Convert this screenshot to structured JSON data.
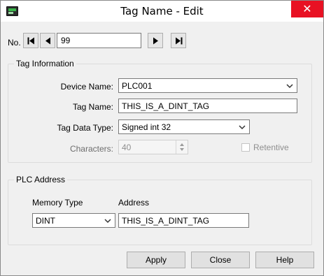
{
  "window": {
    "title": "Tag Name - Edit",
    "close_glyph": "✕"
  },
  "nav": {
    "no_label": "No.",
    "record_value": "99",
    "buttons": [
      {
        "icon": "first-record-icon"
      },
      {
        "icon": "previous-record-icon"
      },
      {
        "icon": "next-record-icon"
      },
      {
        "icon": "last-record-icon"
      }
    ]
  },
  "tag_info": {
    "legend": "Tag Information",
    "device_name_label": "Device Name:",
    "device_name_value": "PLC001",
    "tag_name_label": "Tag Name:",
    "tag_name_value": "THIS_IS_A_DINT_TAG",
    "tag_data_type_label": "Tag Data Type:",
    "tag_data_type_value": "Signed int 32",
    "characters_label": "Characters:",
    "characters_value": "40",
    "retentive_label": "Retentive",
    "retentive_checked": false
  },
  "plc_address": {
    "legend": "PLC Address",
    "memory_type_label": "Memory Type",
    "address_label": "Address",
    "memory_type_value": "DINT",
    "address_value": "THIS_IS_A_DINT_TAG"
  },
  "buttons": {
    "apply": "Apply",
    "close": "Close",
    "help": "Help"
  },
  "colors": {
    "close_button": "#e81123",
    "dialog_background": "#f0f0f0"
  }
}
